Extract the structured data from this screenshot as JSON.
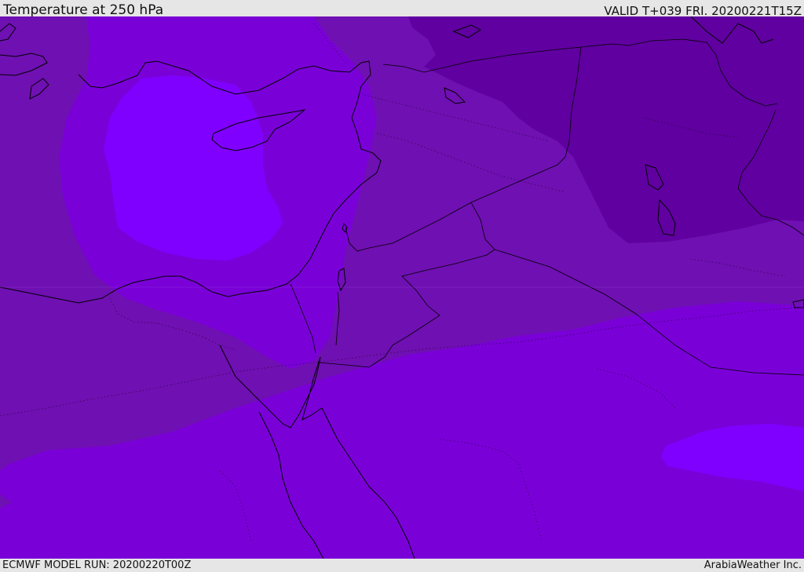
{
  "header": {
    "title": "Temperature at 250 hPa",
    "valid": "VALID T+039 FRI. 20200221T15Z"
  },
  "footer": {
    "model_run": "ECMWF MODEL RUN: 20200220T00Z",
    "credit": "ArabiaWeather Inc."
  },
  "map": {
    "fill_colors": {
      "darkest": "#6000a0",
      "dark": "#6f10b2",
      "medium": "#7a00d8",
      "light": "#8000ff"
    },
    "line_color": "#000000"
  }
}
